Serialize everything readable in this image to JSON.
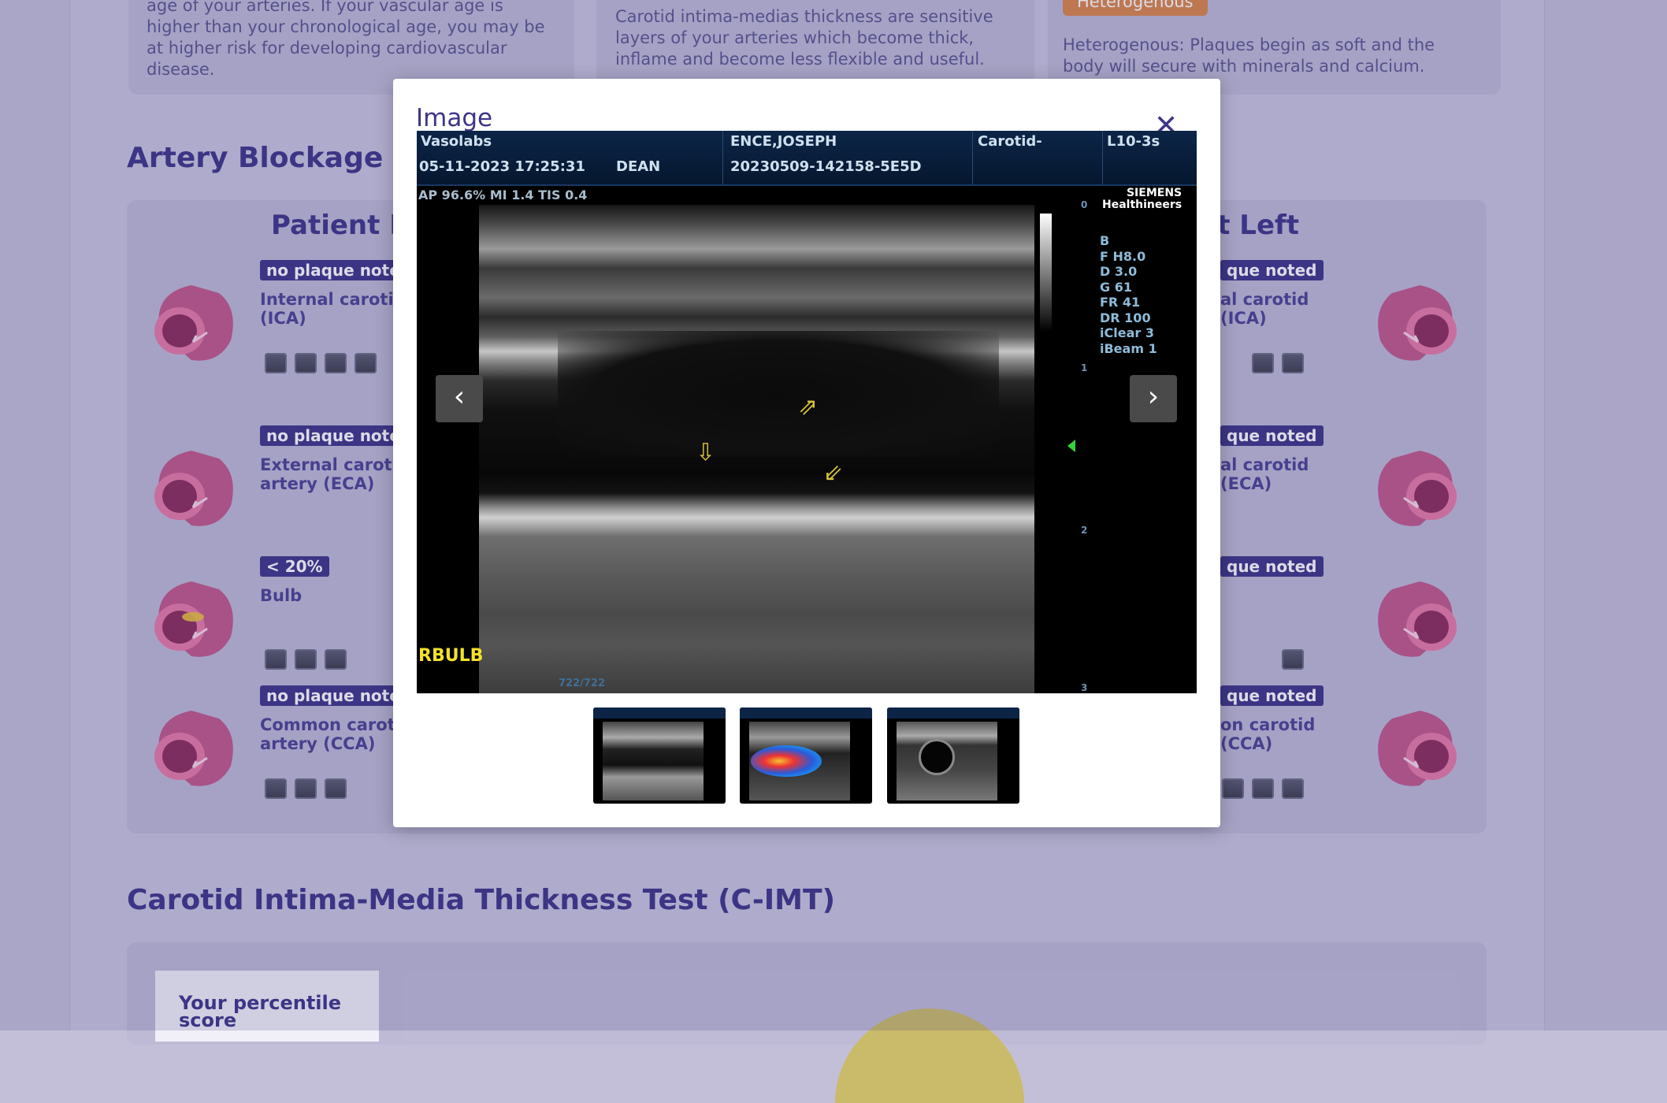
{
  "top_cards": {
    "card1_text": "age of your arteries. If your vascular age is higher than your chronological age, you may be at higher risk for developing cardiovascular disease.",
    "card2_text": "Carotid intima-medias thickness are sensitive layers of your arteries which become thick, inflame and become less flexible and useful.",
    "card3_badge": "Heterogenous",
    "card3_text": "Heterogenous: Plaques begin as soft and the body will secure with minerals and calcium."
  },
  "artery_blockage": {
    "title": "Artery Blockage",
    "right_title": "Patient R",
    "left_title": "nt Left",
    "right_rows": [
      {
        "tag": "no plaque noted",
        "label_line1": "Internal carotid",
        "label_line2": "(ICA)"
      },
      {
        "tag": "no plaque noted",
        "label_line1": "External carotid",
        "label_line2": "artery (ECA)"
      },
      {
        "tag": "< 20%",
        "label_line1": "Bulb",
        "label_line2": ""
      },
      {
        "tag": "no plaque noted",
        "label_line1": "Common carotid",
        "label_line2": "artery (CCA)"
      }
    ],
    "left_rows": [
      {
        "tag": "que noted",
        "label_line1": "al carotid",
        "label_line2": "(ICA)"
      },
      {
        "tag": "que noted",
        "label_line1": "al carotid",
        "label_line2": "(ECA)"
      },
      {
        "tag": "que noted",
        "label_line1": "",
        "label_line2": ""
      },
      {
        "tag": "que noted",
        "label_line1": "on carotid",
        "label_line2": "(CCA)"
      }
    ]
  },
  "cimt": {
    "title": "Carotid Intima-Media Thickness Test (C-IMT)",
    "score_label": "Your percentile score"
  },
  "modal": {
    "title": "Image",
    "close_icon": "close-icon",
    "prev_icon": "chevron-left-icon",
    "next_icon": "chevron-right-icon",
    "ultrasound": {
      "clinic": "Vasolabs",
      "date_time": "05-11-2023  17:25:31",
      "operator": "DEAN",
      "patient": "ENCE,JOSEPH",
      "study_id": "20230509-142158-5E5D",
      "exam": "Carotid-",
      "probe": "L10-3s",
      "power_line": "AP 96.6%  MI 1.4 TIS 0.4",
      "logo_line1": "SIEMENS",
      "logo_line2": "Healthineers",
      "params": [
        "B",
        "F H8.0",
        "D 3.0",
        "G 61",
        "FR 41",
        "DR 100",
        "iClear 3",
        "iBeam 1"
      ],
      "depth_ticks": [
        "0",
        "1",
        "2",
        "3"
      ],
      "label": "RBULB",
      "frame_counter": "722/722"
    },
    "thumbnails": [
      "thumbnail-1",
      "thumbnail-2",
      "thumbnail-3"
    ]
  }
}
